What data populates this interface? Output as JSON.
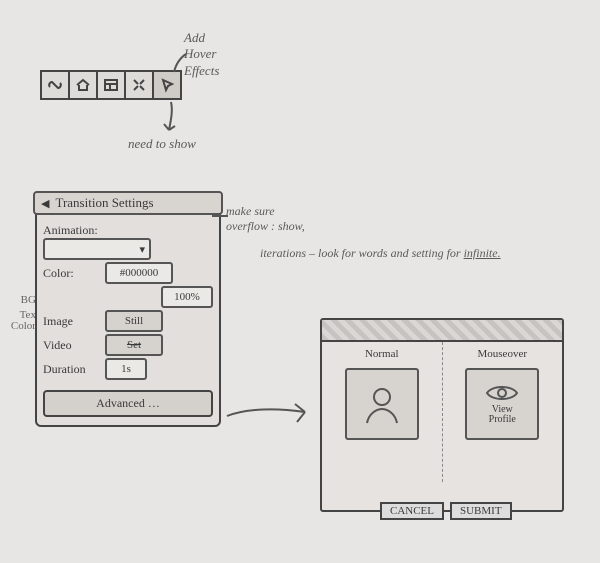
{
  "notes": {
    "add_hover": "Add\nHover\nEffects",
    "need_to_show": "need to show",
    "overflow": "make sure\noverflow : show,",
    "iterations": "iterations – look for words\nand setting for ",
    "infinite": "infinite."
  },
  "toolbar": {
    "icons": [
      "link-icon",
      "home-icon",
      "layout-icon",
      "expand-icon",
      "pointer-icon"
    ]
  },
  "side_labels": {
    "bg": "BG:",
    "text_color": "Text\nColor:"
  },
  "panel": {
    "title": "Transition Settings",
    "animation_label": "Animation:",
    "color_label": "Color:",
    "color_value": "#000000",
    "opacity_value": "100%",
    "image_label": "Image",
    "image_btn": "Still",
    "video_label": "Video",
    "video_btn": "Set",
    "duration_label": "Duration",
    "duration_value": "1s",
    "advanced": "Advanced …"
  },
  "preview": {
    "normal_label": "Normal",
    "mouseover_label": "Mouseover",
    "hover_caption": "View\nProfile",
    "cancel": "CANCEL",
    "submit": "SUBMIT"
  }
}
